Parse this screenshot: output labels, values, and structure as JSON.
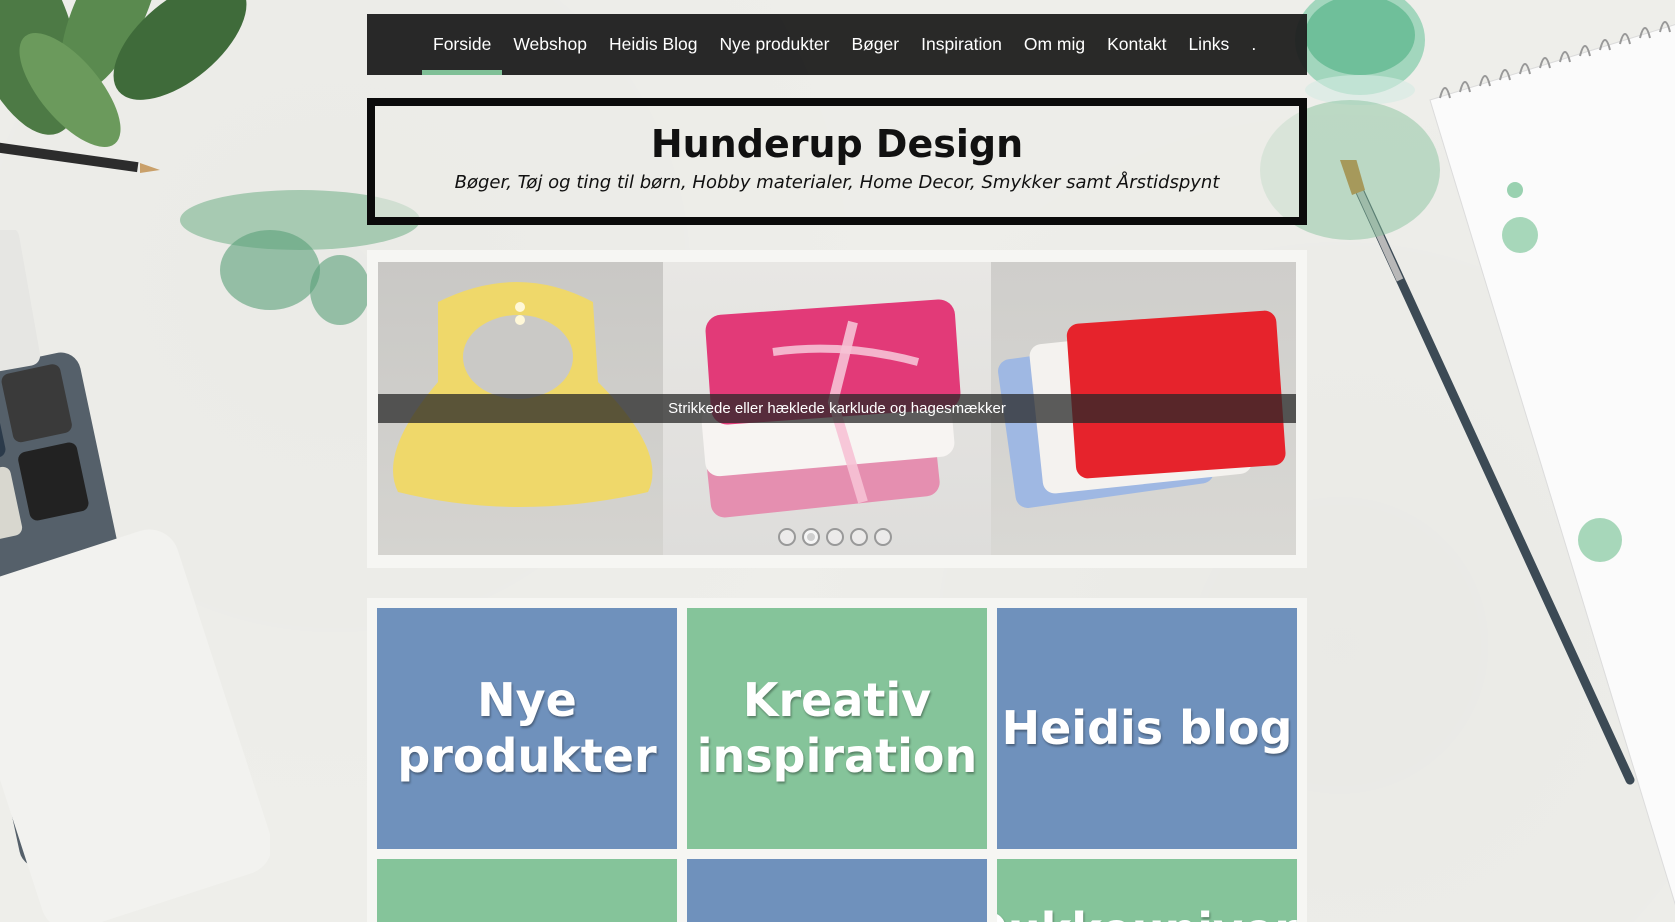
{
  "nav": {
    "items": [
      {
        "label": "Forside",
        "active": true
      },
      {
        "label": "Webshop"
      },
      {
        "label": "Heidis Blog"
      },
      {
        "label": "Nye produkter"
      },
      {
        "label": "Bøger"
      },
      {
        "label": "Inspiration"
      },
      {
        "label": "Om mig"
      },
      {
        "label": "Kontakt"
      },
      {
        "label": "Links"
      },
      {
        "label": "."
      }
    ]
  },
  "header": {
    "title": "Hunderup Design",
    "subtitle": "Bøger, Tøj og ting til børn, Hobby materialer, Home Decor, Smykker samt Årstidspynt"
  },
  "slider": {
    "caption": "Strikkede eller hæklede karklude og hagesmækker",
    "dots": 5,
    "active_dot": 2
  },
  "tiles": {
    "row1": [
      {
        "label": "Nye produkter",
        "color": "blue"
      },
      {
        "label": "Kreativ inspiration",
        "color": "green"
      },
      {
        "label": "Heidis blog",
        "color": "blue"
      }
    ],
    "row2": [
      {
        "label": "",
        "color": "green"
      },
      {
        "label": "",
        "color": "blue"
      },
      {
        "label": "Dukkeunivers",
        "color": "green"
      }
    ]
  },
  "colors": {
    "nav_bg": "#1e1e1e",
    "nav_active": "#7fbf96",
    "tile_blue": "#6f91bc",
    "tile_green": "#85c49a"
  }
}
